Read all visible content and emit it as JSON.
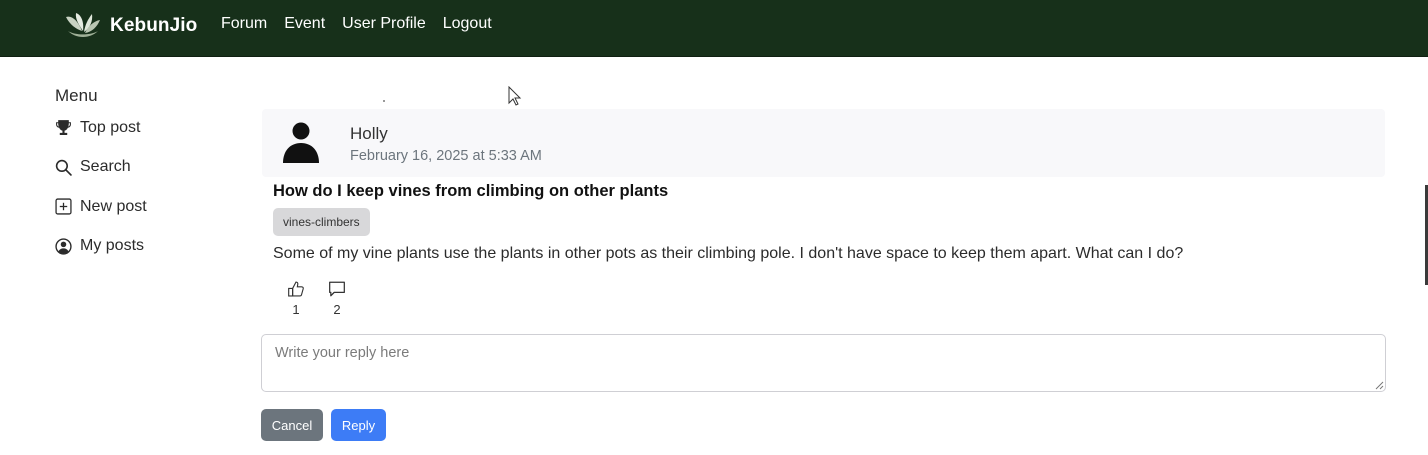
{
  "navbar": {
    "brand": "KebunJio",
    "links": [
      "Forum",
      "Event",
      "User Profile",
      "Logout"
    ],
    "bg_color": "#17301a"
  },
  "sidebar": {
    "title": "Menu",
    "items": [
      {
        "label": "Top post",
        "icon": "trophy-icon"
      },
      {
        "label": "Search",
        "icon": "search-icon"
      },
      {
        "label": "New post",
        "icon": "plus-square-icon"
      },
      {
        "label": "My posts",
        "icon": "person-circle-icon"
      }
    ]
  },
  "post": {
    "author": "Holly",
    "date": "February 16, 2025 at 5:33 AM",
    "title": "How do I keep vines from climbing on other plants",
    "tag": "vines-climbers",
    "body": "Some of my vine plants use the plants in other pots as their climbing pole. I don't have space to keep them apart. What can I do?",
    "likes": "1",
    "comments": "2"
  },
  "reply": {
    "placeholder": "Write your reply here",
    "cancel_label": "Cancel",
    "reply_label": "Reply"
  },
  "colors": {
    "primary_button": "#3d7cf6",
    "secondary_button": "#6c757d"
  }
}
